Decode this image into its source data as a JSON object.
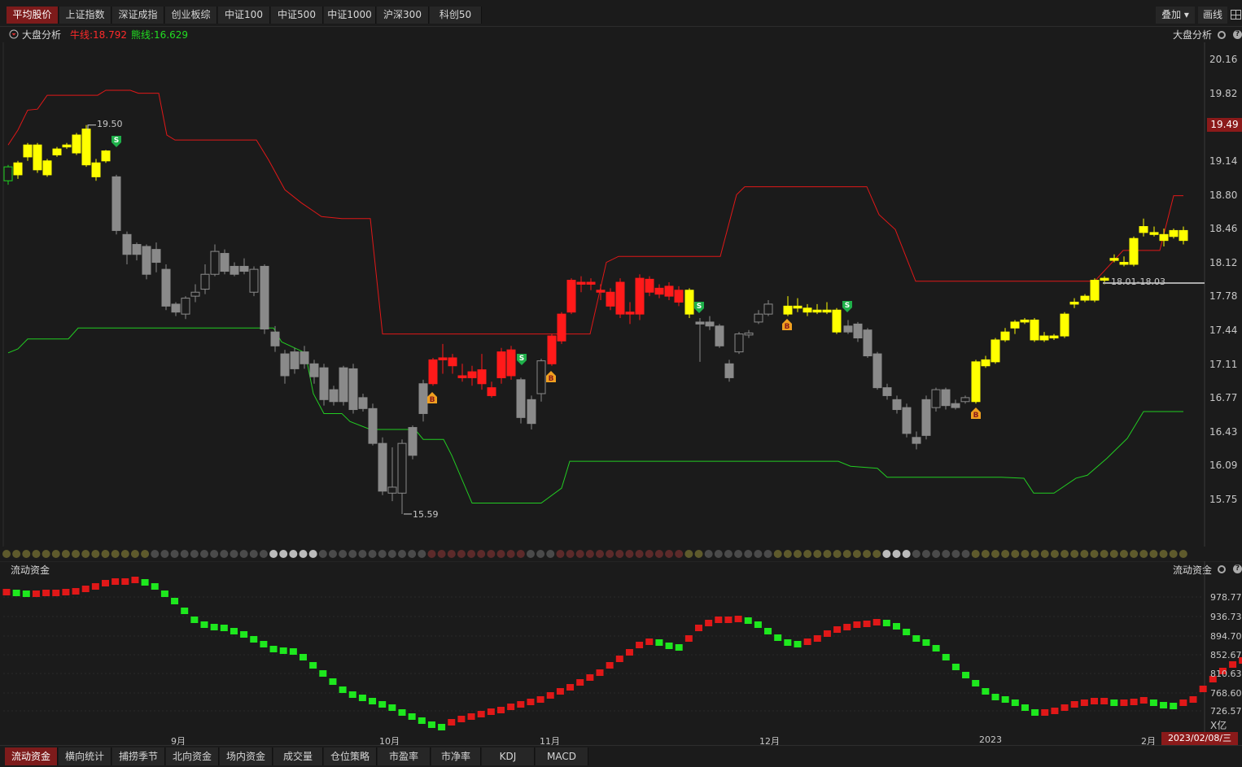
{
  "top_tabs": [
    "平均股价",
    "上证指数",
    "深证成指",
    "创业板综",
    "中证100",
    "中证500",
    "中证1000",
    "沪深300",
    "科创50"
  ],
  "top_right": {
    "overlay": "叠加 ▾",
    "draw": "画线"
  },
  "main_panel": {
    "indicator_name": "大盘分析",
    "bull_label": "牛线:18.792",
    "bear_label": "熊线:16.629",
    "right_title": "大盘分析",
    "price_axis": [
      "20.16",
      "19.82",
      "19.49",
      "19.14",
      "18.80",
      "18.46",
      "18.12",
      "17.78",
      "17.44",
      "17.11",
      "16.77",
      "16.43",
      "16.09",
      "15.75"
    ],
    "current_price": "19.49",
    "high_label": "19.50",
    "low_label": "15.59",
    "range_label": "18.01-18.03",
    "buy_marker": "B",
    "sell_marker": "S"
  },
  "sub_panel": {
    "title": "流动资金",
    "right_title": "流动资金",
    "axis": [
      "978.77",
      "936.73",
      "894.70",
      "852.67",
      "810.63",
      "768.60",
      "726.57"
    ],
    "unit": "X亿"
  },
  "time_axis": [
    "9月",
    "10月",
    "11月",
    "12月",
    "2023",
    "2月"
  ],
  "current_date": "2023/02/08/三",
  "bottom_tabs": [
    "流动资金",
    "横向统计",
    "捕捞季节",
    "北向资金",
    "场内资金",
    "成交量",
    "仓位策略",
    "市盈率",
    "市净率",
    "KDJ",
    "MACD"
  ],
  "colors": {
    "up": "#ff1a1a",
    "down": "#999999",
    "bull_yellow": "#ffff00",
    "green": "#1fd21f",
    "accent": "#7d1b1b"
  }
}
